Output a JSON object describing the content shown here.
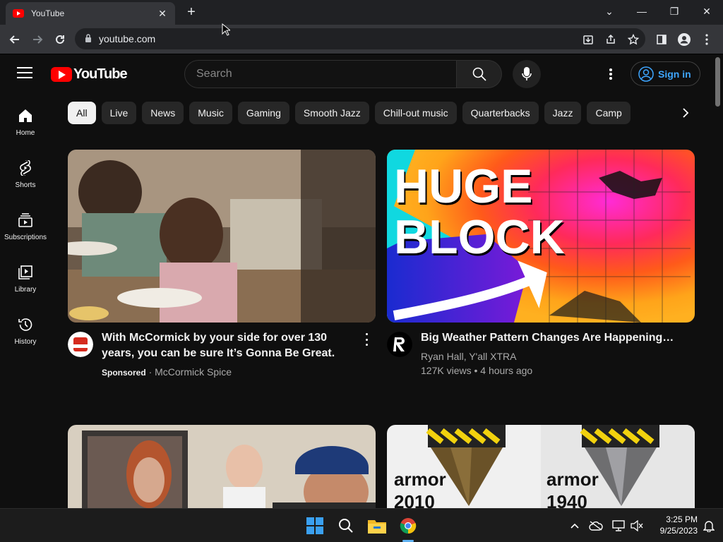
{
  "browser": {
    "tab_title": "YouTube",
    "url": "youtube.com"
  },
  "masthead": {
    "logo_text": "YouTube",
    "search_placeholder": "Search",
    "signin_label": "Sign in"
  },
  "sidebar": {
    "items": [
      {
        "label": "Home",
        "icon": "home-icon"
      },
      {
        "label": "Shorts",
        "icon": "shorts-icon"
      },
      {
        "label": "Subscriptions",
        "icon": "subscriptions-icon"
      },
      {
        "label": "Library",
        "icon": "library-icon"
      },
      {
        "label": "History",
        "icon": "history-icon"
      }
    ]
  },
  "chips": [
    "All",
    "Live",
    "News",
    "Music",
    "Gaming",
    "Smooth Jazz",
    "Chill-out music",
    "Quarterbacks",
    "Jazz",
    "Camp"
  ],
  "videos": [
    {
      "title": "With McCormick by your side for over 130 years, you can be sure It’s Gonna Be Great.",
      "sponsored": "Sponsored",
      "channel": "McCormick Spice"
    },
    {
      "title": "Big Weather Pattern Changes Are Happening…",
      "thumb_text_1": "HUGE",
      "thumb_text_2": "BLOCK",
      "channel": "Ryan Hall, Y'all XTRA",
      "stats": "127K views • 4 hours ago"
    },
    {
      "title": ""
    },
    {
      "thumb_left_1": "armor",
      "thumb_left_2": "2010",
      "thumb_right_1": "armor",
      "thumb_right_2": "1940"
    }
  ],
  "taskbar": {
    "time": "3:25 PM",
    "date": "9/25/2023"
  },
  "colors": {
    "youtube_red": "#ff0000",
    "link_blue": "#3ea6ff",
    "background": "#0f0f0f"
  }
}
